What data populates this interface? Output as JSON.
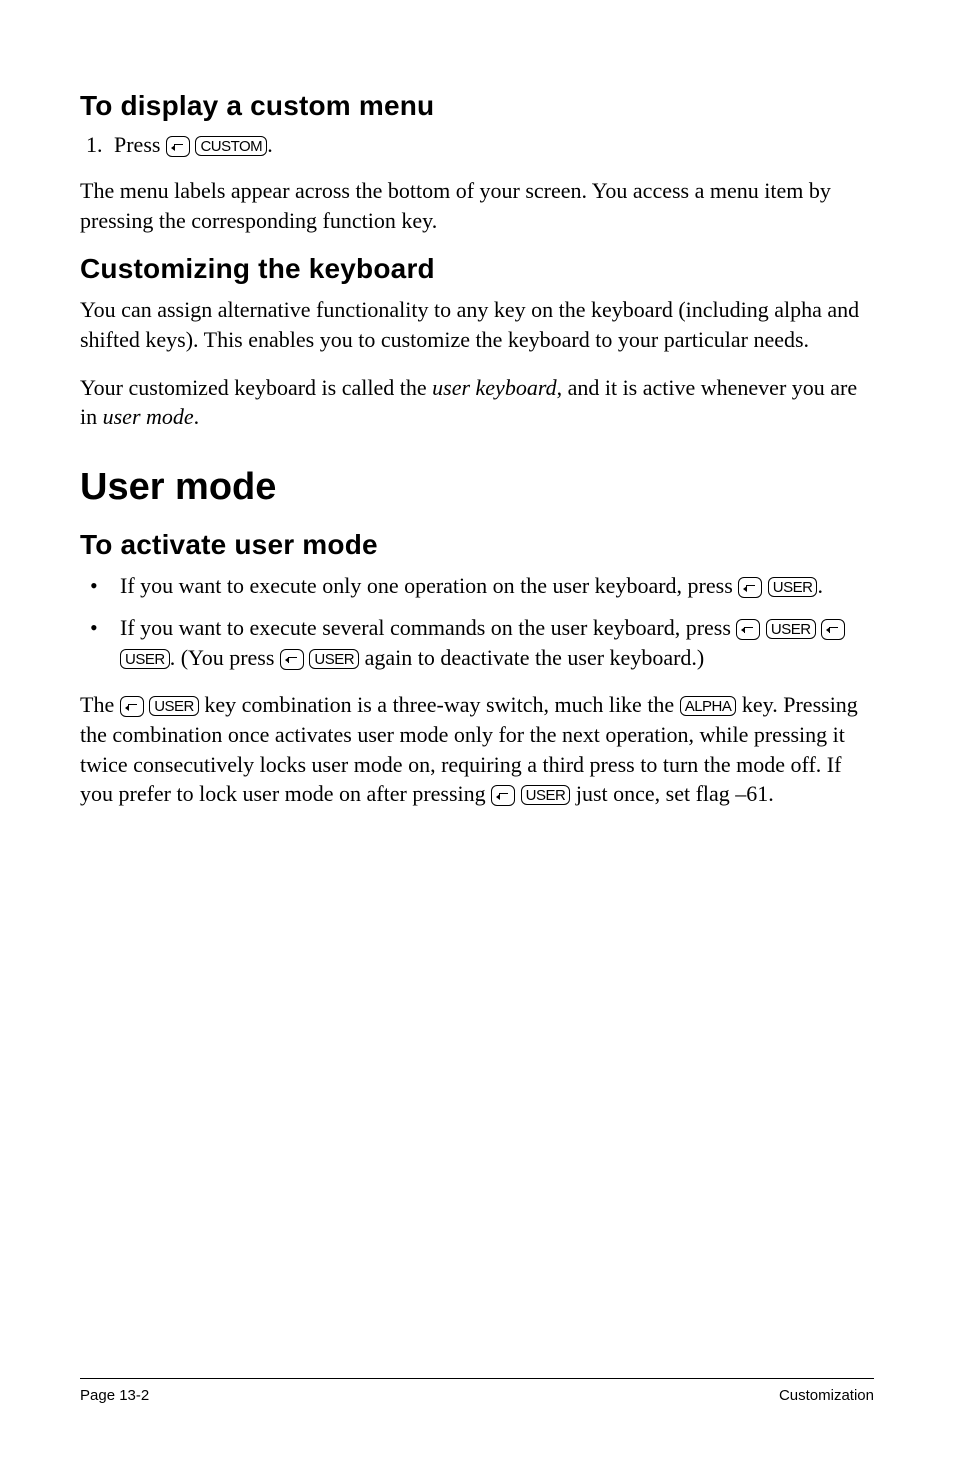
{
  "sections": {
    "display_custom": {
      "heading": "To display a custom menu",
      "step1_prefix": "Press ",
      "step1_key": "CUSTOM",
      "step1_suffix": ".",
      "para1": "The menu labels appear across the bottom of your screen. You access a menu item by pressing the corresponding function key."
    },
    "customizing": {
      "heading": "Customizing the keyboard",
      "para1": "You can assign alternative functionality to any key on the keyboard (including alpha and shifted keys). This enables you to customize the keyboard to your particular needs.",
      "para2_a": "Your customized keyboard is called the ",
      "para2_i1": "user keyboard",
      "para2_b": ", and it is active whenever you are in ",
      "para2_i2": "user mode",
      "para2_c": "."
    },
    "user_mode": {
      "title": "User mode",
      "heading": "To activate user mode",
      "bullet1_a": "If you want to execute only one operation on the user keyboard, press ",
      "bullet1_key": "USER",
      "bullet1_b": ".",
      "bullet2_a": "If you want to execute several commands on the user keyboard, press ",
      "bullet2_key1": "USER",
      "bullet2_key2": "USER",
      "bullet2_b": ". (You press ",
      "bullet2_key3": "USER",
      "bullet2_c": " again to deactivate the user keyboard.)",
      "para_a": "The ",
      "para_key1": "USER",
      "para_b": " key combination is a three-way switch, much like the ",
      "para_key2": "ALPHA",
      "para_c": " key. Pressing the combination once activates user mode only for the next operation, while pressing it twice consecutively locks user mode on, requiring a third press to turn the mode off. If you prefer to lock user mode on after pressing ",
      "para_key3": "USER",
      "para_d": " just once, set flag –61."
    }
  },
  "footer": {
    "left": "Page 13-2",
    "right": "Customization"
  }
}
